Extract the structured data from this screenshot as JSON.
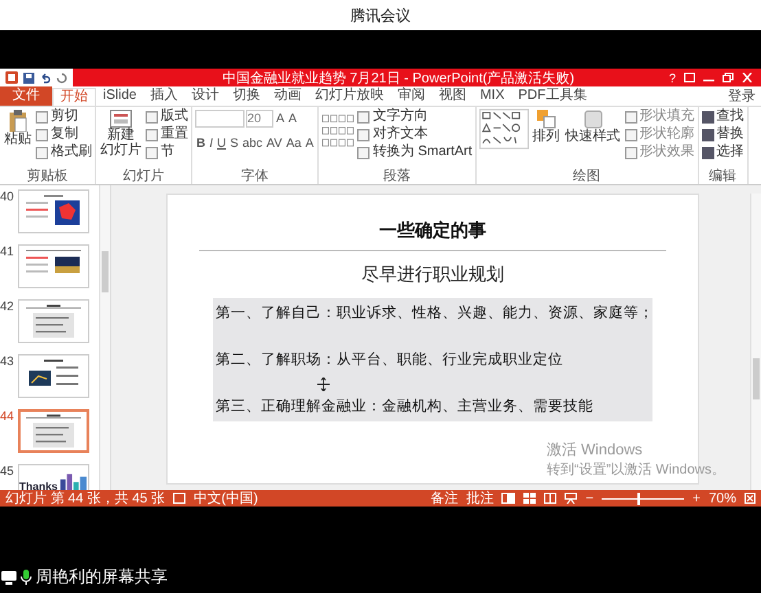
{
  "meeting_window": {
    "title": "腾讯会议"
  },
  "ppt": {
    "title": "中国金融业就业趋势 7月21日 - PowerPoint(产品激活失败)",
    "help": "?",
    "login": "登录",
    "tabs": [
      {
        "label": "文件",
        "kind": "file",
        "selected": false
      },
      {
        "label": "开始",
        "kind": "tab",
        "selected": true
      },
      {
        "label": "iSlide",
        "kind": "tab",
        "selected": false
      },
      {
        "label": "插入",
        "kind": "tab",
        "selected": false
      },
      {
        "label": "设计",
        "kind": "tab",
        "selected": false
      },
      {
        "label": "切换",
        "kind": "tab",
        "selected": false
      },
      {
        "label": "动画",
        "kind": "tab",
        "selected": false
      },
      {
        "label": "幻灯片放映",
        "kind": "tab",
        "selected": false
      },
      {
        "label": "审阅",
        "kind": "tab",
        "selected": false
      },
      {
        "label": "视图",
        "kind": "tab",
        "selected": false
      },
      {
        "label": "MIX",
        "kind": "tab",
        "selected": false
      },
      {
        "label": "PDF工具集",
        "kind": "tab",
        "selected": false
      }
    ],
    "ribbon": [
      {
        "kind": "clipboard",
        "label": "剪贴板",
        "paste": "粘贴",
        "items": [
          "剪切",
          "复制",
          "格式刷"
        ]
      },
      {
        "kind": "slides",
        "label": "幻灯片",
        "new_slide": [
          "新建",
          "幻灯片"
        ],
        "items": [
          "版式",
          "重置",
          "节"
        ]
      },
      {
        "kind": "font",
        "label": "字体",
        "size": "20",
        "size_buttons": [
          "A",
          "A"
        ],
        "style_buttons": [
          "B",
          "I",
          "U",
          "S",
          "abc",
          "AV",
          "Aa",
          "A"
        ]
      },
      {
        "kind": "paragraph",
        "label": "段落",
        "items": [
          "文字方向",
          "对齐文本",
          "转换为 SmartArt"
        ]
      },
      {
        "kind": "drawing",
        "label": "绘图",
        "arrange": "排列",
        "quick_styles": "快速样式",
        "items": [
          "形状填充",
          "形状轮廓",
          "形状效果"
        ]
      },
      {
        "kind": "editing",
        "label": "编辑",
        "items": [
          "查找",
          "替换",
          "选择"
        ]
      }
    ]
  },
  "thumbnails": [
    {
      "number": "40",
      "kind": "map",
      "selected": false
    },
    {
      "number": "41",
      "kind": "photo",
      "selected": false
    },
    {
      "number": "42",
      "kind": "text",
      "selected": false
    },
    {
      "number": "43",
      "kind": "chart",
      "selected": false
    },
    {
      "number": "44",
      "kind": "text",
      "selected": true
    },
    {
      "number": "45",
      "kind": "thanks",
      "caption": "Thanks",
      "selected": false
    }
  ],
  "slide": {
    "title": "一些确定的事",
    "subtitle": "尽早进行职业规划",
    "points": [
      "第一、了解自己：职业诉求、性格、兴趣、能力、资源、家庭等；",
      "第二、了解职场：从平台、职能、行业完成职业定位",
      "第三、正确理解金融业：金融机构、主营业务、需要技能"
    ]
  },
  "activation": {
    "title": "激活 Windows",
    "hint": "转到“设置”以激活 Windows。"
  },
  "status_bar": {
    "slide_info": "幻灯片 第 44 张，共 45 张",
    "language": "中文(中国)",
    "notes": "备注",
    "comments": "批注",
    "zoom": {
      "out": "−",
      "in": "+",
      "level": 0.45,
      "reading": "70%"
    }
  },
  "share": {
    "label": "周艳利的屏幕共享"
  }
}
